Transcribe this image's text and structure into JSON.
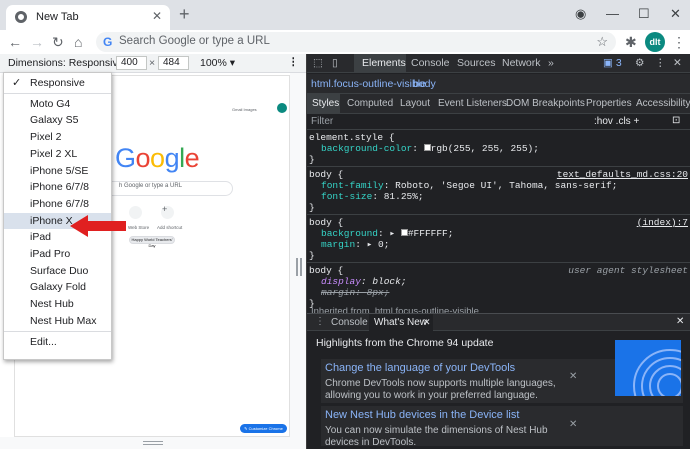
{
  "browser": {
    "tab_title": "New Tab",
    "tab_close": "✕",
    "new_tab": "+",
    "omnibox_placeholder": "Search Google or type a URL",
    "avatar_text": "dlt"
  },
  "device_toolbar": {
    "label": "Dimensions: Responsive ▾",
    "width": "400",
    "times": "×",
    "height": "484",
    "zoom": "100% ▾",
    "more": "⋮"
  },
  "device_menu": {
    "items": [
      {
        "label": "Responsive",
        "checked": true
      },
      {
        "label": "Moto G4"
      },
      {
        "label": "Galaxy S5"
      },
      {
        "label": "Pixel 2"
      },
      {
        "label": "Pixel 2 XL"
      },
      {
        "label": "iPhone 5/SE"
      },
      {
        "label": "iPhone 6/7/8"
      },
      {
        "label": "iPhone 6/7/8 Plus"
      },
      {
        "label": "iPhone X",
        "highlighted": true
      },
      {
        "label": "iPad"
      },
      {
        "label": "iPad Pro"
      },
      {
        "label": "Surface Duo"
      },
      {
        "label": "Galaxy Fold"
      },
      {
        "label": "Nest Hub"
      },
      {
        "label": "Nest Hub Max"
      },
      {
        "label": "Edit..."
      }
    ]
  },
  "page": {
    "logo_letters": [
      {
        "ch": "G",
        "color": "#4285f4"
      },
      {
        "ch": "o",
        "color": "#ea4335"
      },
      {
        "ch": "o",
        "color": "#fbbc05"
      },
      {
        "ch": "g",
        "color": "#4285f4"
      },
      {
        "ch": "l",
        "color": "#34a853"
      },
      {
        "ch": "e",
        "color": "#ea4335"
      }
    ],
    "search_placeholder": "h Google or type a URL",
    "top_links": "Gmail   Images",
    "shortcut1": "Web Store",
    "shortcut2": "Add shortcut",
    "doodle": "Happy World Teachers' Day",
    "customize": "✎ Customize Chrome"
  },
  "devtools": {
    "tabs": [
      "Elements",
      "Console",
      "Sources",
      "Network",
      "»"
    ],
    "issues": "3",
    "crumbs": [
      "html.focus-outline-visible",
      "body"
    ],
    "subtabs": [
      "Styles",
      "Computed",
      "Layout",
      "Event Listeners",
      "DOM Breakpoints",
      "Properties",
      "Accessibility"
    ],
    "filter_placeholder": "Filter",
    "filter_tools": ":hov  .cls  +",
    "rules": {
      "r1_sel": "element.style {",
      "r1_p": "background-color",
      "r1_v": "rgb(255, 255, 255);",
      "r2_sel": "body {",
      "r2_src": "text_defaults_md.css:20",
      "r2_p1": "font-family",
      "r2_v1": "Roboto, 'Segoe UI', Tahoma, sans-serif;",
      "r2_p2": "font-size",
      "r2_v2": "81.25%;",
      "r3_sel": "body {",
      "r3_src": "(index):7",
      "r3_p1": "background",
      "r3_v1": "#FFFFFF;",
      "r3_p2": "margin",
      "r3_v2": "0;",
      "r4_sel": "body {",
      "r4_src": "user agent stylesheet",
      "r4_p1": "display",
      "r4_v1": "block;",
      "r4_p2": "margin",
      "r4_v2": "8px;",
      "close": "}",
      "inherited": "Inherited from  html.focus-outline-visible"
    },
    "drawer_tabs": [
      "Console",
      "What's New"
    ],
    "drawer_close": "✕",
    "whats_new_heading": "Highlights from the Chrome 94 update",
    "cards": [
      {
        "title": "Change the language of your DevTools",
        "desc": "Chrome DevTools now supports multiple languages, allowing you to work in your preferred language."
      },
      {
        "title": "New Nest Hub devices in the Device list",
        "desc": "You can now simulate the dimensions of Nest Hub devices in DevTools."
      }
    ]
  }
}
